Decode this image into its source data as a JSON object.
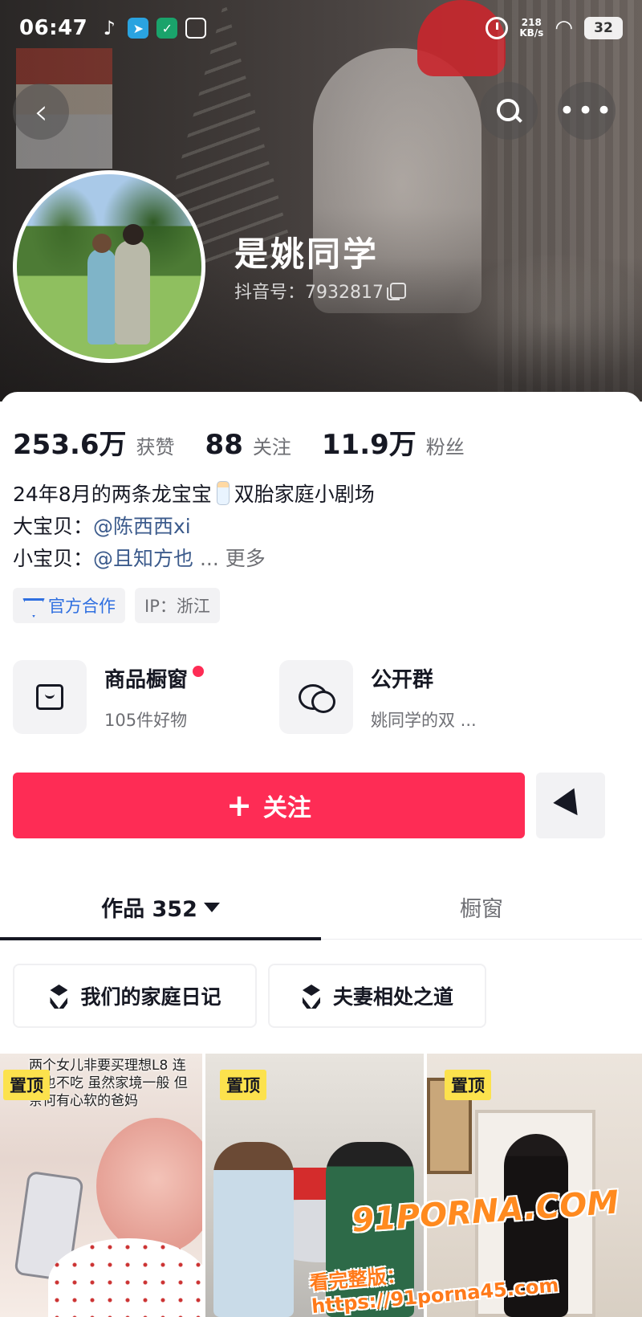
{
  "status_bar": {
    "time": "06:47",
    "net_speed_value": "218",
    "net_speed_unit": "KB/s",
    "battery": "32"
  },
  "profile": {
    "nickname": "是姚同学",
    "douyin_id": "抖音号：7932817"
  },
  "stats": [
    {
      "value": "253.6万",
      "label": "获赞"
    },
    {
      "value": "88",
      "label": "关注"
    },
    {
      "value": "11.9万",
      "label": "粉丝"
    }
  ],
  "bio": {
    "line1_a": "24年8月的两条龙宝宝",
    "line1_b": "双胎家庭小剧场",
    "line2_prefix": "大宝贝：",
    "line2_mention": "@陈西西xi",
    "line3_prefix": "小宝贝：",
    "line3_mention": "@且知方也",
    "line3_more": "... 更多"
  },
  "tags": {
    "official": "官方合作",
    "ip": "IP：浙江"
  },
  "shop": {
    "title": "商品橱窗",
    "subtitle": "105件好物"
  },
  "group": {
    "title": "公开群",
    "subtitle": "姚同学的双 ..."
  },
  "follow_label": "关注",
  "tabs": [
    {
      "label": "作品 352"
    },
    {
      "label": "橱窗"
    }
  ],
  "collections": [
    {
      "label": "我们的家庭日记"
    },
    {
      "label": "夫妻相处之道"
    }
  ],
  "videos": [
    {
      "badge": "置顶",
      "caption": "两个女儿非要买理想L8 连奶也不吃 虽然家境一般 但奈何有心软的爸妈"
    },
    {
      "badge": "置顶"
    },
    {
      "badge": "置顶"
    }
  ],
  "watermarks": {
    "brand": "91PORNA.COM",
    "line": "看完整版：https://91porna45.com"
  },
  "colors": {
    "accent": "#fe2c55",
    "mention": "#3c5b8c",
    "official": "#2f6fe0",
    "pin_badge": "#fce24d"
  }
}
